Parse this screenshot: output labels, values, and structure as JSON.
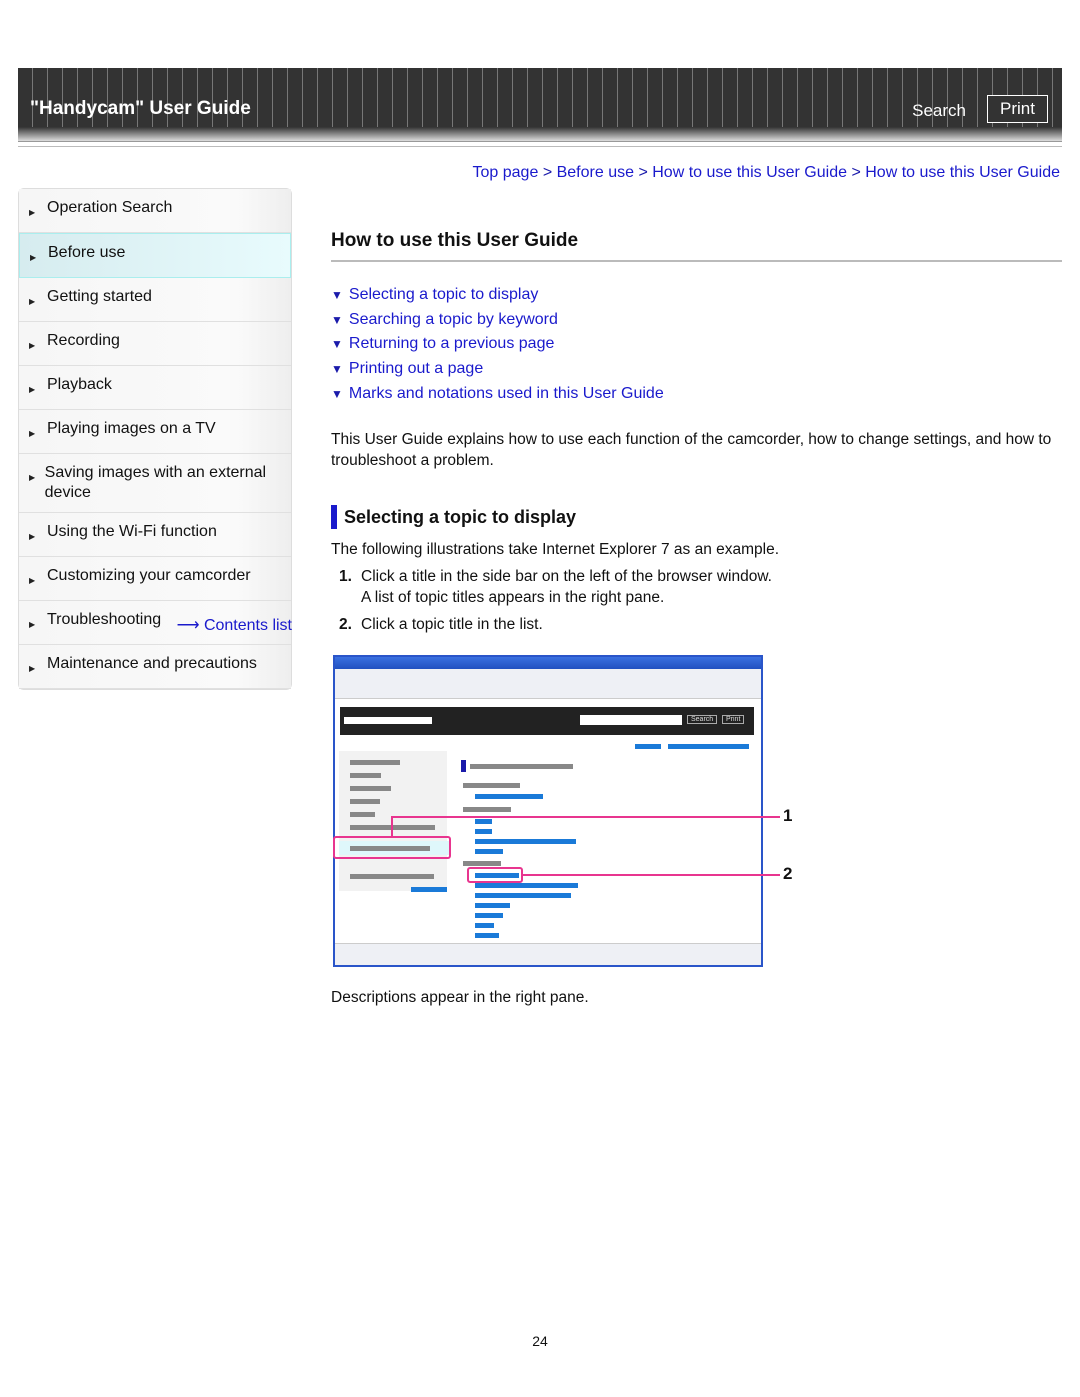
{
  "header": {
    "title": "\"Handycam\" User Guide",
    "search": "Search",
    "print": "Print"
  },
  "breadcrumb": [
    "Top page",
    "Before use",
    "How to use this User Guide",
    "How to use this User Guide"
  ],
  "breadcrumb_sep": ">",
  "sidebar": {
    "items": [
      {
        "label": "Operation Search"
      },
      {
        "label": "Before use",
        "active": true
      },
      {
        "label": "Getting started"
      },
      {
        "label": "Recording"
      },
      {
        "label": "Playback"
      },
      {
        "label": "Playing images on a TV"
      },
      {
        "label": "Saving images with an external device"
      },
      {
        "label": "Using the Wi-Fi function"
      },
      {
        "label": "Customizing your camcorder"
      },
      {
        "label": "Troubleshooting"
      },
      {
        "label": "Maintenance and precautions"
      }
    ],
    "contents_list": "Contents list"
  },
  "main": {
    "title": "How to use this User Guide",
    "toc": [
      "Selecting a topic to display",
      "Searching a topic by keyword",
      "Returning to a previous page",
      "Printing out a page",
      "Marks and notations used in this User Guide"
    ],
    "intro": "This User Guide explains how to use each function of the camcorder, how to change settings, and how to troubleshoot a problem.",
    "section_title": "Selecting a topic to display",
    "section_intro": "The following illustrations take Internet Explorer 7 as an example.",
    "steps": [
      {
        "num": "1.",
        "text": "Click a title in the side bar on the left of the browser window.",
        "sub": "A list of topic titles appears in the right pane."
      },
      {
        "num": "2.",
        "text": "Click a topic title in the list."
      }
    ],
    "callouts": [
      "1",
      "2"
    ],
    "illustration_buttons": [
      "Search",
      "Print"
    ],
    "after": "Descriptions appear in the right pane."
  },
  "page_number": "24",
  "colors": {
    "link": "#1a1acc",
    "accent": "#1a1acc",
    "highlight": "#e8358f"
  }
}
